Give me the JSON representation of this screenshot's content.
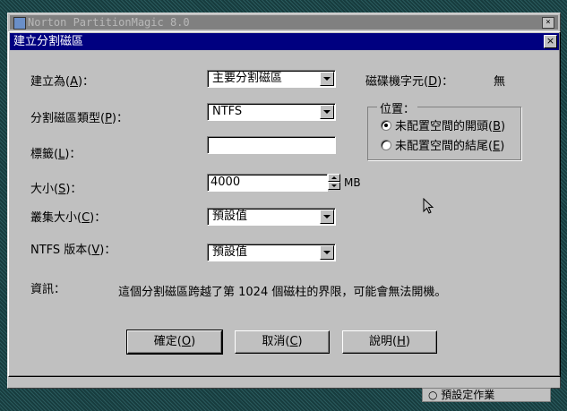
{
  "background_window": {
    "title": "Norton PartitionMagic 8.0",
    "bottom_item": "○ 預設定作業"
  },
  "dialog": {
    "title": "建立分割磁區",
    "close_label": "×"
  },
  "fields": {
    "create_as": {
      "label": "建立為(",
      "key": "A",
      "suffix": ")：",
      "value": "主要分割磁區"
    },
    "partition_type": {
      "label": "分割磁區類型(",
      "key": "P",
      "suffix": ")：",
      "value": "NTFS"
    },
    "label": {
      "label": "標籤(",
      "key": "L",
      "suffix": ")：",
      "value": ""
    },
    "size": {
      "label": "大小(",
      "key": "S",
      "suffix": ")：",
      "value": "4000",
      "unit": "MB"
    },
    "cluster_size": {
      "label": "叢集大小(",
      "key": "C",
      "suffix": ")：",
      "value": "預設值"
    },
    "ntfs_version": {
      "label": "NTFS 版本(",
      "key": "V",
      "suffix": ")：",
      "value": "預設值"
    },
    "drive_letter": {
      "label": "磁碟機字元(",
      "key": "D",
      "suffix": ")：",
      "value": "無"
    }
  },
  "position": {
    "legend": "位置：",
    "options": [
      {
        "label": "未配置空間的開頭(",
        "key": "B",
        "suffix": ")",
        "selected": true
      },
      {
        "label": "未配置空間的結尾(",
        "key": "E",
        "suffix": ")",
        "selected": false
      }
    ]
  },
  "info": {
    "label": "資訊：",
    "text": "這個分割磁區跨越了第 1024 個磁柱的界限，可能會無法開機。"
  },
  "buttons": {
    "ok": {
      "label": "確定(",
      "key": "O",
      "suffix": ")"
    },
    "cancel": {
      "label": "取消(",
      "key": "C",
      "suffix": ")"
    },
    "help": {
      "label": "說明(",
      "key": "H",
      "suffix": ")"
    }
  },
  "icons": {
    "cursor": "mouse-pointer-icon",
    "close": "close-icon"
  }
}
